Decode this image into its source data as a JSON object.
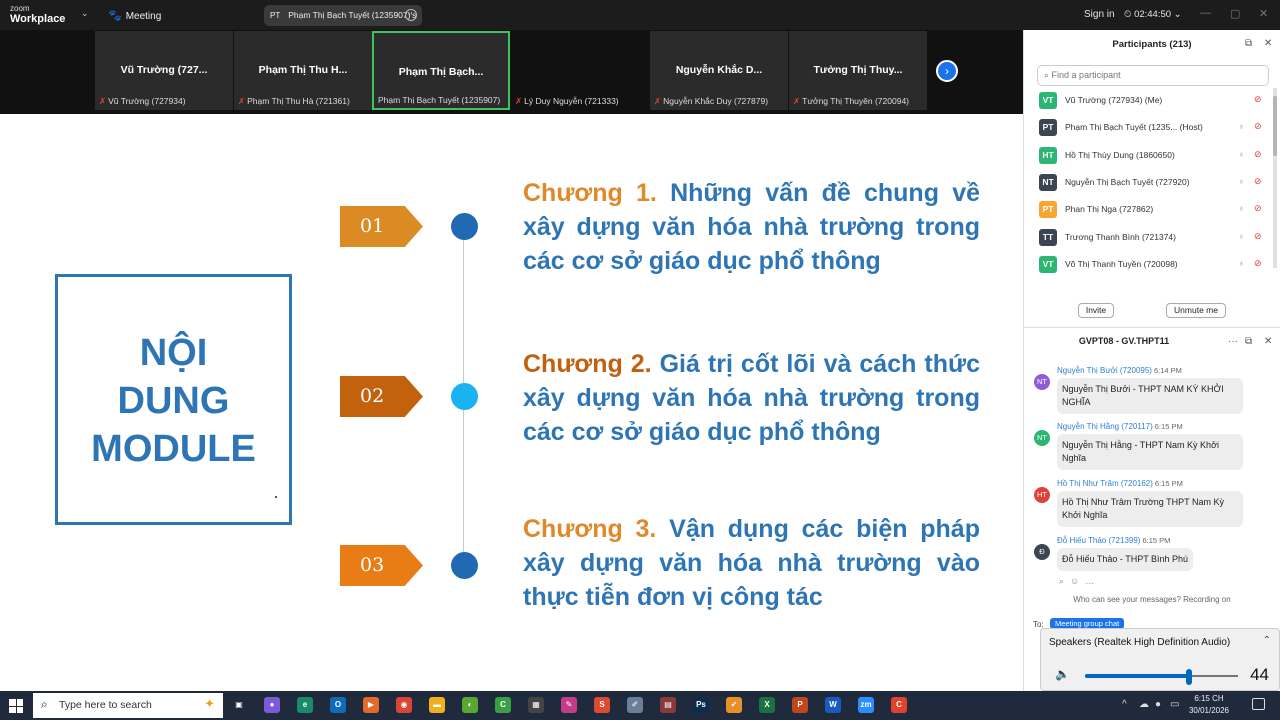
{
  "titlebar": {
    "logo_top": "zoom",
    "logo_bottom": "Workplace",
    "meeting_label": "Meeting",
    "sharing_avatar": "PT",
    "sharing_name": "Phạm Thị Bạch Tuyết (1235907)'s",
    "sign_in": "Sign in",
    "timer": "02:44:50"
  },
  "video_strip": [
    {
      "big": "Vũ Trường (727...",
      "small": "Vũ Trường (727934)",
      "muted": true
    },
    {
      "big": "Phạm Thị Thu H...",
      "small": "Phạm Thị Thu Hà (721361)",
      "muted": true
    },
    {
      "big": "Phạm Thị Bạch...",
      "small": "Phạm Thị Bạch Tuyết (1235907)",
      "muted": false
    },
    {
      "big": "",
      "small": "Lý Duy Nguyễn (721333)",
      "muted": true
    },
    {
      "big": "Nguyễn Khắc D...",
      "small": "Nguyễn Khắc Duy (727879)",
      "muted": true
    },
    {
      "big": "Tưởng Thị Thuy...",
      "small": "Tưởng Thị Thuyên (720094)",
      "muted": true
    }
  ],
  "slide": {
    "module_title_lines": [
      "NỘI",
      "DUNG",
      "MODULE"
    ],
    "chapters": [
      {
        "num_label": "01",
        "prefix": "Chương ",
        "number": "1.",
        "text": " Những vấn đề chung về xây dựng văn hóa nhà trường trong các cơ sở giáo dục phổ thông"
      },
      {
        "num_label": "02",
        "prefix": "Chương ",
        "number": "2.",
        "text": " Giá trị cốt lõi và cách thức xây dựng văn hóa nhà trường trong các cơ sở giáo dục phổ thông"
      },
      {
        "num_label": "03",
        "prefix": "Chương ",
        "number": "3.",
        "text": " Vận dụng các biện pháp xây dựng văn hóa nhà trường vào thực tiễn đơn vị công tác"
      }
    ]
  },
  "participants": {
    "title": "Participants (213)",
    "search_placeholder": "Find a participant",
    "list": [
      {
        "initials": "VT",
        "name": "Vũ Trường (727934) (Me)",
        "color": "#2bb673"
      },
      {
        "initials": "PT",
        "name": "Phạm Thị Bạch Tuyết (1235... (Host)",
        "color": "#3b4652"
      },
      {
        "initials": "HT",
        "name": "Hồ Thị Thùy Dung (1860650)",
        "color": "#2bb673"
      },
      {
        "initials": "NT",
        "name": "Nguyễn Thị Bạch Tuyết (727920)",
        "color": "#3b4652"
      },
      {
        "initials": "PT",
        "name": "Phan Thị Nga (727862)",
        "color": "#f7a631"
      },
      {
        "initials": "TT",
        "name": "Trương Thanh Bình (721374)",
        "color": "#3b4652"
      },
      {
        "initials": "VT",
        "name": "Võ Thị Thanh Tuyền (720098)",
        "color": "#2bb673"
      }
    ],
    "invite": "Invite",
    "unmute": "Unmute me"
  },
  "chat": {
    "title": "GVPT08 - GV.THPT11",
    "messages": [
      {
        "initials": "NT",
        "color": "#8e5cd9",
        "sender": "Nguyễn Thị Bưởi (720095)",
        "time": "6:14 PM",
        "text": "Nguyễn Thị Bưởi - THPT NAM KỲ KHỞI NGHĨA"
      },
      {
        "initials": "NT",
        "color": "#2bb673",
        "sender": "Nguyễn Thị Hằng (720117)",
        "time": "6:15 PM",
        "text": "Nguyễn Thị Hằng - THPT Nam Kỳ Khởi Nghĩa"
      },
      {
        "initials": "HT",
        "color": "#e0413a",
        "sender": "Hồ Thị Như Trâm (720162)",
        "time": "6:15 PM",
        "text": "Hồ Thị Như Trâm Trường THPT Nam Kỳ Khởi Nghĩa"
      },
      {
        "initials": "Đ",
        "color": "#3b4652",
        "sender": "Đỗ Hiếu Thảo (721399)",
        "time": "6:15 PM",
        "text": "Đỗ Hiếu Thảo - THPT Bình Phú"
      }
    ],
    "who_can_see": "Who can see your messages? Recording on",
    "to_label": "To:",
    "recipient": "Meeting group chat"
  },
  "speakers": {
    "label": "Speakers (Realtek High Definition Audio)",
    "volume": 44
  },
  "taskbar": {
    "search_placeholder": "Type here to search",
    "time": "6:15 CH",
    "date": "30/01/2026"
  },
  "colors": {
    "accent": "#1a73e8",
    "slide_blue": "#2e75b6",
    "chapter_orange": "#e0892a",
    "active_tile": "#41c35c"
  }
}
